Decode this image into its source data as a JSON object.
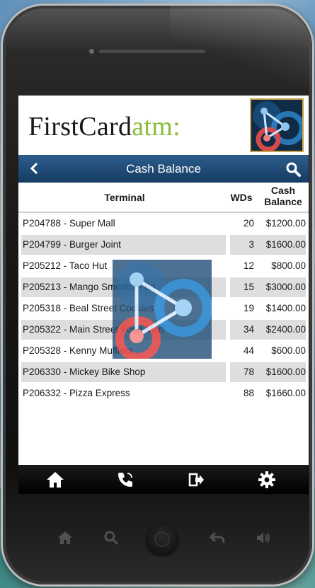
{
  "brand": {
    "logo_main": "FirstCard",
    "logo_accent": "atm:",
    "accent_color": "#8dbb3a"
  },
  "navbar": {
    "title": "Cash Balance",
    "back_icon": "chevron-left-icon",
    "search_icon": "search-icon"
  },
  "table": {
    "headers": {
      "terminal": "Terminal",
      "wds": "WDs",
      "cash_line1": "Cash",
      "cash_line2": "Balance"
    },
    "rows": [
      {
        "name": "P204788 - Super Mall",
        "wds": "20",
        "balance": "$1200.00"
      },
      {
        "name": "P204799 - Burger Joint",
        "wds": "3",
        "balance": "$1600.00"
      },
      {
        "name": "P205212 - Taco Hut",
        "wds": "12",
        "balance": "$800.00"
      },
      {
        "name": "P205213 - Mango Smoothie Ba",
        "wds": "15",
        "balance": "$3000.00"
      },
      {
        "name": "P205318 - Beal Street Cookies",
        "wds": "19",
        "balance": "$1400.00"
      },
      {
        "name": "P205322 - Main Street Food Mart",
        "wds": "34",
        "balance": "$2400.00"
      },
      {
        "name": "P205328 - Kenny Mufflers",
        "wds": "44",
        "balance": "$600.00"
      },
      {
        "name": "P206330 - Mickey Bike Shop",
        "wds": "78",
        "balance": "$1600.00"
      },
      {
        "name": "P206332 - Pizza Express",
        "wds": "88",
        "balance": "$1660.00"
      }
    ]
  },
  "tabbar": {
    "items": [
      "home-icon",
      "phone-icon",
      "logout-icon",
      "gear-icon"
    ]
  },
  "device": {
    "hardware_icons": [
      "home-icon",
      "search-icon",
      "back-icon",
      "volume-icon"
    ]
  }
}
